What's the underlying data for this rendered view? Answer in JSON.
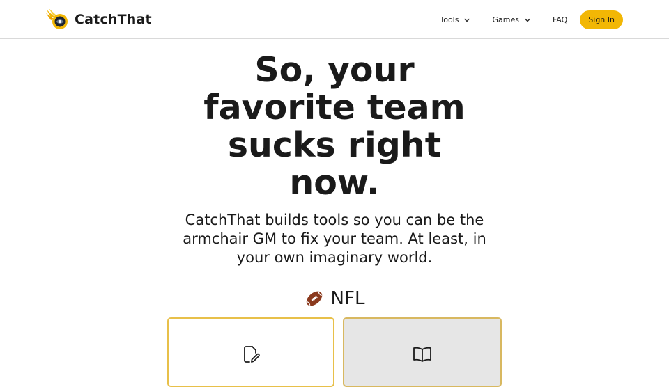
{
  "brand": {
    "name": "CatchThat",
    "logo_icon": "flaming-football-logo"
  },
  "nav": {
    "tools_label": "Tools",
    "games_label": "Games",
    "faq_label": "FAQ",
    "signin_label": "Sign In"
  },
  "hero": {
    "title_lines": [
      "So, your",
      "favorite team",
      "sucks right",
      "now."
    ],
    "subtitle_lines": [
      "CatchThat builds tools so you can be the",
      "armchair GM to fix your team. At least, in",
      "your own imaginary world."
    ]
  },
  "section": {
    "icon": "football-icon",
    "label": "NFL"
  },
  "cards": [
    {
      "icon": "edit-document-icon",
      "label": ""
    },
    {
      "icon": "open-book-icon",
      "label": ""
    }
  ],
  "colors": {
    "accent": "#f2b705",
    "card_border": "#e8c04a",
    "card_alt_bg": "#e6e6e6",
    "text": "#1a1a1a"
  }
}
